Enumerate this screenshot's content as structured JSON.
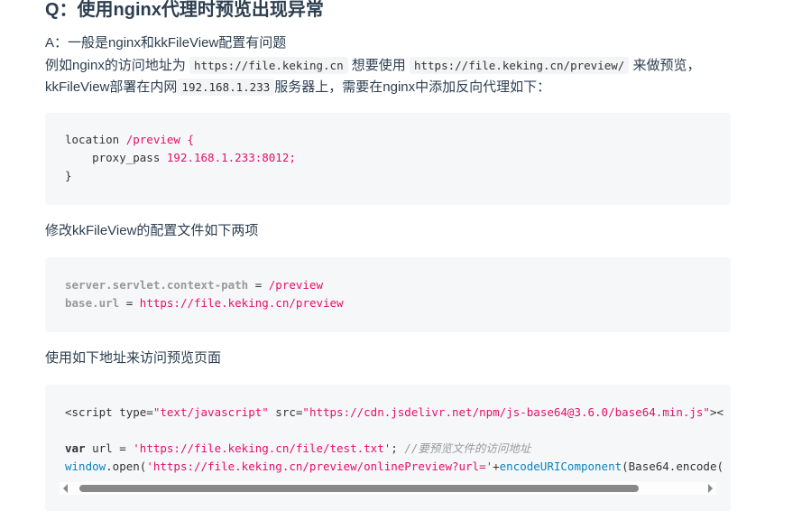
{
  "title": "Q：使用nginx代理时预览出现异常",
  "answer": {
    "line1": "A：一般是nginx和kkFileView配置有问题",
    "line2_a": "例如nginx的访问地址为",
    "line2_code1": "https://file.keking.cn",
    "line2_b": "想要使用",
    "line2_code2": "https://file.keking.cn/preview/",
    "line2_c": "来做预览，",
    "line3_a": "kkFileView部署在内网",
    "line3_code": "192.168.1.233",
    "line3_b": "服务器上，需要在nginx中添加反向代理如下："
  },
  "code1": {
    "l1a": "location ",
    "l1b": "/preview {",
    "l2a": "    proxy_pass ",
    "l2b": "192.168.1.233:8012;",
    "l3": "}"
  },
  "para2": "修改kkFileView的配置文件如下两项",
  "code2": {
    "k1": "server.servlet.context-path",
    "eq": " = ",
    "v1": "/preview",
    "k2": "base.url",
    "v2": "https://file.keking.cn/preview"
  },
  "para3": "使用如下地址来访问预览页面",
  "code3": {
    "l1a": "<script type=",
    "l1b": "\"text/javascript\"",
    "l1c": " src=",
    "l1d": "\"https://cdn.jsdelivr.net/npm/js-base64@3.6.0/base64.min.js\"",
    "l1e": "><",
    "l2a": "var",
    "l2b": " url = ",
    "l2c": "'https://file.keking.cn/file/test.txt'",
    "l2d": "; ",
    "l2e": "//要预览文件的访问地址",
    "l3a": "window",
    "l3b": ".open(",
    "l3c": "'https://file.keking.cn/preview/onlinePreview?url='",
    "l3d": "+",
    "l3e": "encodeURIComponent",
    "l3f": "(Base64.encode("
  }
}
